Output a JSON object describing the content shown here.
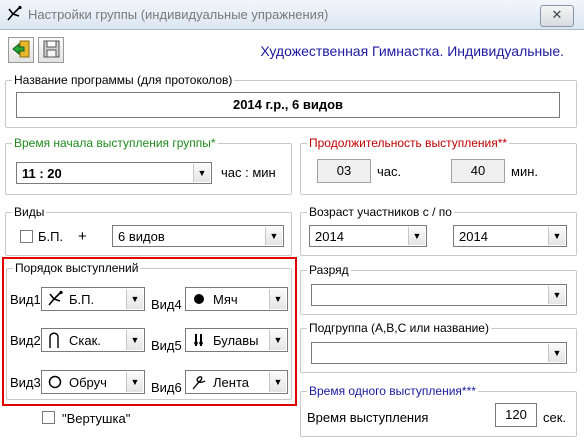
{
  "window": {
    "title": "Настройки группы (индивидуальные упражнения)",
    "close_label": "✕"
  },
  "toolbar": {
    "app_title": "Художественная Гимнастка. Индивидуальные.",
    "exit_icon": "exit-icon",
    "save_icon": "save-icon"
  },
  "program": {
    "legend": "Название программы (для протоколов)",
    "value": "2014 г.р., 6 видов"
  },
  "start_time": {
    "legend": "Время начала выступления группы*",
    "value": "11 : 20",
    "unit": "час : мин"
  },
  "duration": {
    "legend": "Продолжительность выступления**",
    "hours": "03",
    "hours_label": "час.",
    "minutes": "40",
    "minutes_label": "мин."
  },
  "kinds": {
    "legend": "Виды",
    "bp_label": "Б.П.",
    "plus": "+",
    "value": "6 видов"
  },
  "age": {
    "legend": "Возраст участников с / по",
    "from": "2014",
    "to": "2014"
  },
  "order": {
    "legend": "Порядок выступлений",
    "items": [
      {
        "label": "Вид1",
        "value": "Б.П.",
        "icon": "gymnast-icon"
      },
      {
        "label": "Вид2",
        "value": "Скак.",
        "icon": "rope-icon"
      },
      {
        "label": "Вид3",
        "value": "Обруч",
        "icon": "hoop-icon"
      },
      {
        "label": "Вид4",
        "value": "Мяч",
        "icon": "ball-icon"
      },
      {
        "label": "Вид5",
        "value": "Булавы",
        "icon": "clubs-icon"
      },
      {
        "label": "Вид6",
        "value": "Лента",
        "icon": "ribbon-icon"
      }
    ]
  },
  "rank": {
    "legend": "Разряд",
    "value": ""
  },
  "subgroup": {
    "legend": "Подгруппа (А,В,С или название)",
    "value": ""
  },
  "spin": {
    "label": "\"Вертушка\""
  },
  "performance": {
    "legend": "Время одного выступления***",
    "label": "Время выступления",
    "value": "120",
    "unit": "сек."
  },
  "colors": {
    "green": "#1e8a1e",
    "red": "#c00000",
    "blue": "#1a1aa0",
    "frame": "#e00000"
  }
}
